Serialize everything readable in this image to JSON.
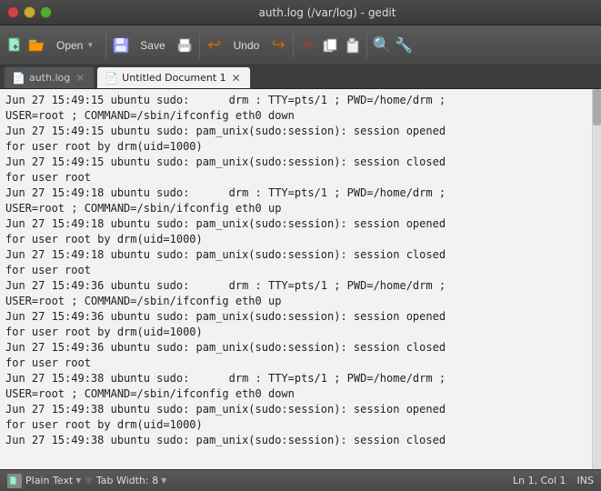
{
  "window": {
    "title": "auth.log (/var/log) - gedit"
  },
  "toolbar": {
    "new_label": "",
    "open_label": "Open",
    "save_label": "Save",
    "undo_label": "Undo"
  },
  "tabs": [
    {
      "id": "auth-log",
      "label": "auth.log",
      "active": false,
      "icon": "📄"
    },
    {
      "id": "untitled",
      "label": "Untitled Document 1",
      "active": true,
      "icon": "📄"
    }
  ],
  "editor": {
    "content": "Jun 27 15:49:15 ubuntu sudo:      drm : TTY=pts/1 ; PWD=/home/drm ;\nUSER=root ; COMMAND=/sbin/ifconfig eth0 down\nJun 27 15:49:15 ubuntu sudo: pam_unix(sudo:session): session opened\nfor user root by drm(uid=1000)\nJun 27 15:49:15 ubuntu sudo: pam_unix(sudo:session): session closed\nfor user root\nJun 27 15:49:18 ubuntu sudo:      drm : TTY=pts/1 ; PWD=/home/drm ;\nUSER=root ; COMMAND=/sbin/ifconfig eth0 up\nJun 27 15:49:18 ubuntu sudo: pam_unix(sudo:session): session opened\nfor user root by drm(uid=1000)\nJun 27 15:49:18 ubuntu sudo: pam_unix(sudo:session): session closed\nfor user root\nJun 27 15:49:36 ubuntu sudo:      drm : TTY=pts/1 ; PWD=/home/drm ;\nUSER=root ; COMMAND=/sbin/ifconfig eth0 up\nJun 27 15:49:36 ubuntu sudo: pam_unix(sudo:session): session opened\nfor user root by drm(uid=1000)\nJun 27 15:49:36 ubuntu sudo: pam_unix(sudo:session): session closed\nfor user root\nJun 27 15:49:38 ubuntu sudo:      drm : TTY=pts/1 ; PWD=/home/drm ;\nUSER=root ; COMMAND=/sbin/ifconfig eth0 down\nJun 27 15:49:38 ubuntu sudo: pam_unix(sudo:session): session opened\nfor user root by drm(uid=1000)\nJun 27 15:49:38 ubuntu sudo: pam_unix(sudo:session): session closed"
  },
  "status": {
    "file_type": "Plain Text",
    "tab_width": "Tab Width: 8",
    "cursor": "Ln 1, Col 1",
    "mode": "INS"
  }
}
